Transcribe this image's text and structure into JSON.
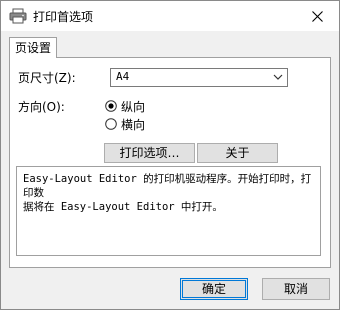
{
  "window": {
    "title": "打印首选项"
  },
  "tabs": [
    {
      "label": "页设置"
    }
  ],
  "page_size": {
    "label": "页尺寸(Z):",
    "selected": "A4"
  },
  "orientation": {
    "label": "方向(O):",
    "options": [
      {
        "label": "纵向",
        "checked": true
      },
      {
        "label": "横向",
        "checked": false
      }
    ]
  },
  "buttons": {
    "print_options": "打印选项…",
    "about": "关于",
    "ok": "确定",
    "cancel": "取消"
  },
  "description": "Easy-Layout Editor 的打印机驱动程序。开始打印时，打印数\n据将在 Easy-Layout Editor 中打开。",
  "colors": {
    "focus_border": "#0078d7",
    "button_bg": "#e1e1e1",
    "window_bg": "#f0f0f0"
  }
}
